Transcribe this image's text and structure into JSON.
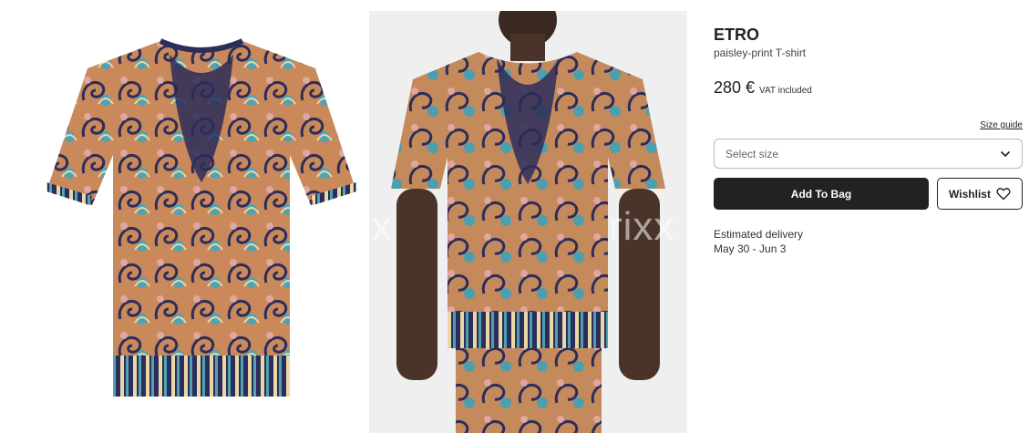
{
  "product": {
    "brand": "ETRO",
    "name": "paisley-print T-shirt",
    "price": "280 €",
    "vat_note": "VAT included"
  },
  "size": {
    "guide_label": "Size guide",
    "select_placeholder": "Select size"
  },
  "actions": {
    "add_to_bag": "Add To Bag",
    "wishlist": "Wishlist"
  },
  "delivery": {
    "label": "Estimated delivery",
    "dates": "May 30 - Jun 3"
  },
  "gallery": {
    "watermark_text": "rixx"
  },
  "colors": {
    "button_dark": "#222222",
    "border": "#b9b9b9"
  }
}
